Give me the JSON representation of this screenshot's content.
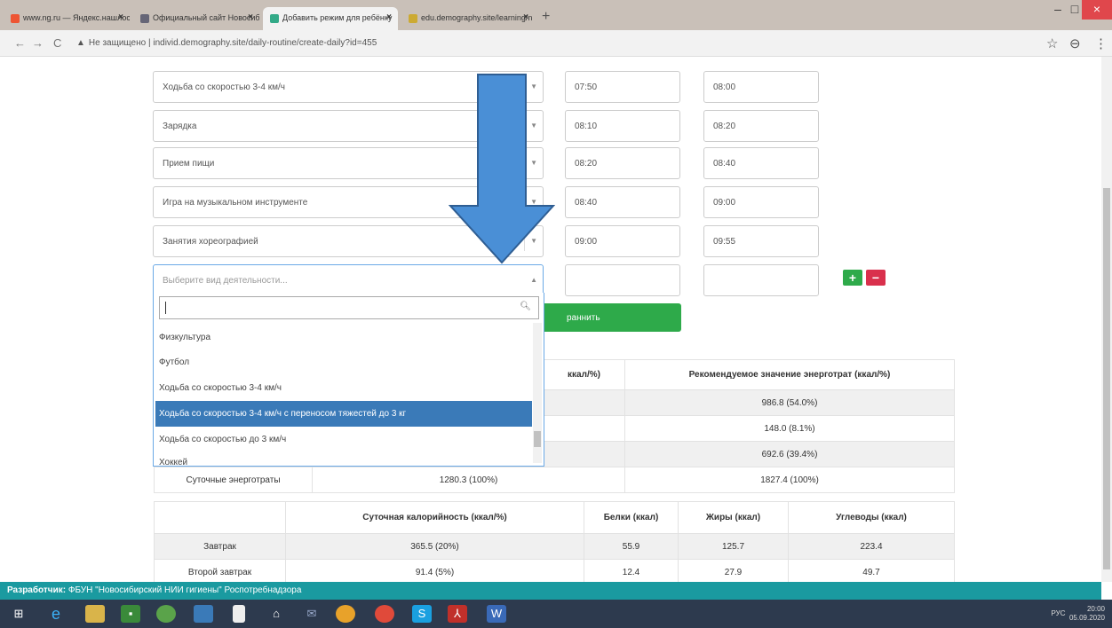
{
  "browser": {
    "tabs": [
      {
        "label": "www.ng.ru — Яндекс.нашлось",
        "fav": "#e53"
      },
      {
        "label": "Официальный сайт Новосибир",
        "fav": "#667"
      },
      {
        "label": "Добавить режим для ребёнку",
        "fav": "#3a8",
        "active": true
      },
      {
        "label": "edu.demography.site/learning/n",
        "fav": "#ca3"
      }
    ],
    "url_warning": "Не защищено",
    "url": "individ.demography.site/daily-routine/create-daily?id=455"
  },
  "rows": [
    {
      "activity": "Ходьба со скоростью 3-4 км/ч",
      "start": "07:50",
      "end": "08:00"
    },
    {
      "activity": "Зарядка",
      "start": "08:10",
      "end": "08:20"
    },
    {
      "activity": "Прием пищи",
      "start": "08:20",
      "end": "08:40"
    },
    {
      "activity": "Игра на музыкальном инструменте",
      "start": "08:40",
      "end": "09:00"
    },
    {
      "activity": "Занятия хореографией",
      "start": "09:00",
      "end": "09:55"
    }
  ],
  "new_row": {
    "placeholder": "Выберите вид деятельности...",
    "add": "+",
    "remove": "−"
  },
  "save_button": "раннить",
  "dropdown": {
    "options": [
      "Физкультура",
      "Футбол",
      "Ходьба со скоростью 3-4 км/ч",
      "Ходьба со скоростью 3-4 км/ч с переносом тяжестей до 3 кг",
      "Ходьба со скоростью до 3 км/ч",
      "Хоккей"
    ],
    "selected_index": 3
  },
  "energy_table": {
    "col2": "ккал/%)",
    "col3": "Рекомендуемое значение энерготрат (ккал/%)",
    "values": [
      "986.8 (54.0%)",
      "148.0 (8.1%)",
      "692.6 (39.4%)"
    ],
    "total_label": "Суточные энерготраты",
    "total_actual": "1280.3 (100%)",
    "total_recommended": "1827.4 (100%)"
  },
  "meal_table": {
    "headers": [
      "",
      "Суточная калорийность (ккал/%)",
      "Белки (ккал)",
      "Жиры (ккал)",
      "Углеводы (ккал)"
    ],
    "rows": [
      [
        "Завтрак",
        "365.5 (20%)",
        "55.9",
        "125.7",
        "223.4"
      ],
      [
        "Второй завтрак",
        "91.4 (5%)",
        "12.4",
        "27.9",
        "49.7"
      ]
    ]
  },
  "footer": {
    "label": "Разработчик:",
    "text": " ФБУН \"Новосибирский НИИ гигиены\" Роспотребнадзора"
  },
  "tray": {
    "lang": "РУС",
    "time": "20:00",
    "date": "05.09.2020"
  },
  "colors": {
    "accent": "#3a7ab8",
    "footer": "#1a9aa0",
    "arrow": "#4a8fd6"
  }
}
